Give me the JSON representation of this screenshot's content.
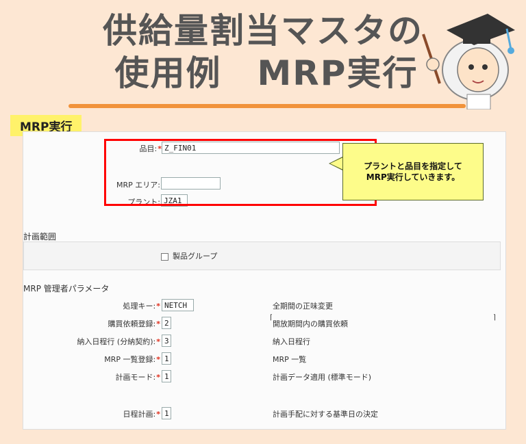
{
  "header": {
    "title_line1": "供給量割当マスタの",
    "title_line2": "使用例　MRP実行"
  },
  "section_tag": "MRP実行",
  "form": {
    "material_label": "品目:",
    "material_value": "Z_FIN01",
    "mrp_area_label": "MRP エリア:",
    "mrp_area_value": "",
    "plant_label": "プラント:",
    "plant_value": "JZA1"
  },
  "callout": {
    "line1": "プラントと品目を指定して",
    "line2": "MRP実行していきます。"
  },
  "planning_scope": {
    "title": "計画範囲",
    "checkbox_label": "製品グループ"
  },
  "mrp_params": {
    "title": "MRP 管理者パラメータ",
    "rows": [
      {
        "label": "処理キー:",
        "value": "NETCH",
        "desc": "全期間の正味変更"
      },
      {
        "label": "購買依頼登録:",
        "value": "2",
        "desc": "開放期間内の購買依頼"
      },
      {
        "label": "納入日程行 (分納契約):",
        "value": "3",
        "desc": "納入日程行"
      },
      {
        "label": "MRP 一覧登録:",
        "value": "1",
        "desc": "MRP 一覧"
      },
      {
        "label": "計画モード:",
        "value": "1",
        "desc": "計画データ適用 (標準モード)"
      },
      {
        "label": "日程計画:",
        "value": "1",
        "desc": "計画手配に対する基準日の決定"
      }
    ]
  },
  "colors": {
    "background": "#fde7d3",
    "highlight_red": "#ff0000",
    "callout_yellow": "#fdfc8a",
    "tag_yellow": "#fff26a"
  }
}
